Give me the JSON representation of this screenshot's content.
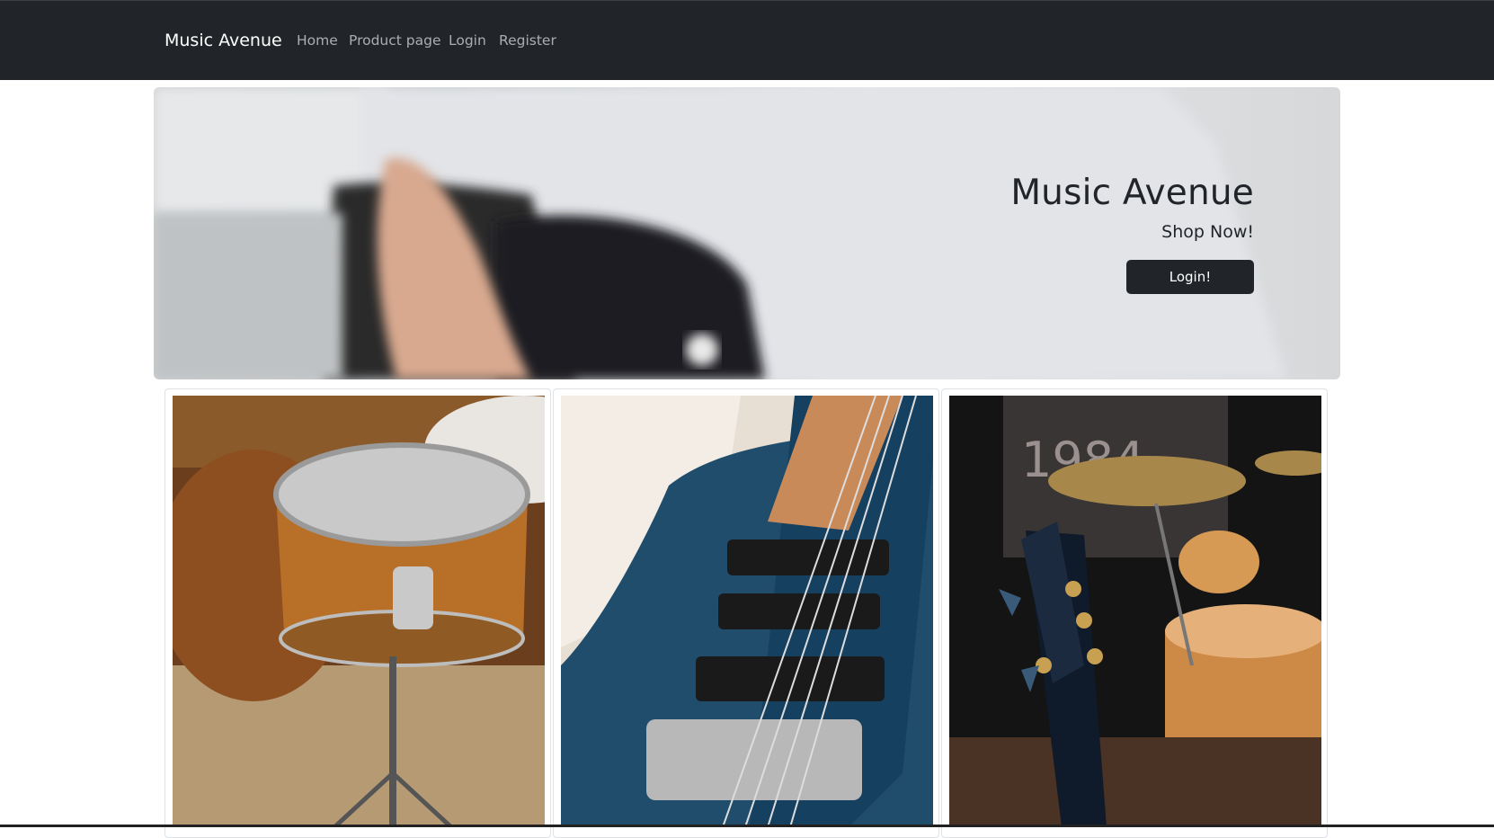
{
  "navbar": {
    "brand": "Music Avenue",
    "links": [
      {
        "label": "Home"
      },
      {
        "label": "Product page"
      },
      {
        "label": "Login"
      },
      {
        "label": "Register"
      }
    ]
  },
  "hero": {
    "title": "Music Avenue",
    "subtitle": "Shop Now!",
    "button_label": "Login!"
  },
  "products": [
    {
      "image": "drum-kit-photo"
    },
    {
      "image": "electric-guitar-photo"
    },
    {
      "image": "bass-guitar-and-drums-photo"
    }
  ],
  "colors": {
    "navbar_bg": "#212529",
    "button_bg": "#212529",
    "page_bg": "#ffffff"
  }
}
